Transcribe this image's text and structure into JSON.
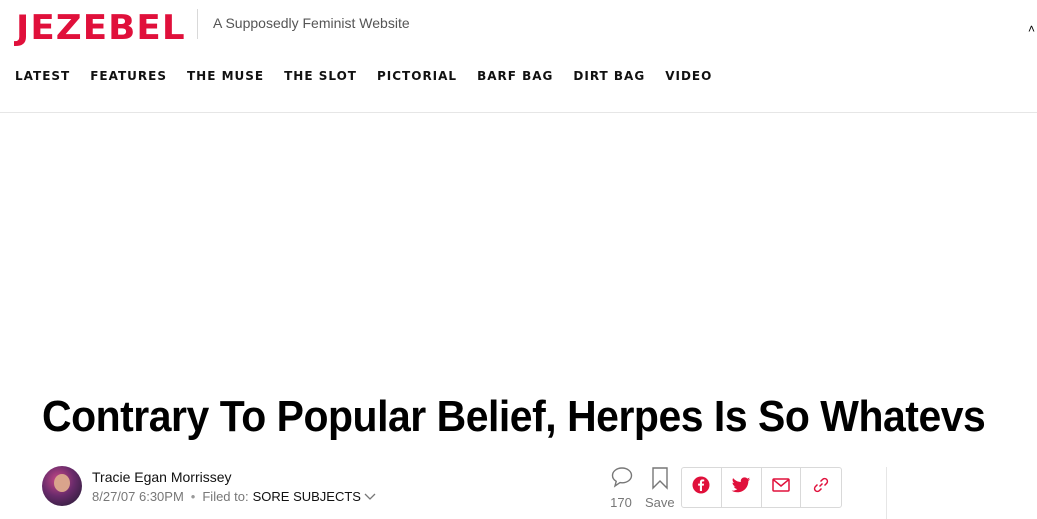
{
  "site": {
    "logo": "JEZEBEL",
    "tagline": "A Supposedly Feminist Website"
  },
  "nav": {
    "items": [
      "LATEST",
      "FEATURES",
      "THE MUSE",
      "THE SLOT",
      "PICTORIAL",
      "BARF BAG",
      "DIRT BAG",
      "VIDEO"
    ]
  },
  "article": {
    "title": "Contrary To Popular Belief, Herpes Is So Whatevs",
    "author": "Tracie Egan Morrissey",
    "timestamp": "8/27/07 6:30PM",
    "filed_label": "Filed to:",
    "filed_category": "SORE SUBJECTS",
    "comment_count": "170",
    "save_label": "Save"
  },
  "icons": {
    "brand_color": "#e0103b",
    "share": [
      "facebook-icon",
      "twitter-icon",
      "email-icon",
      "link-icon"
    ]
  }
}
